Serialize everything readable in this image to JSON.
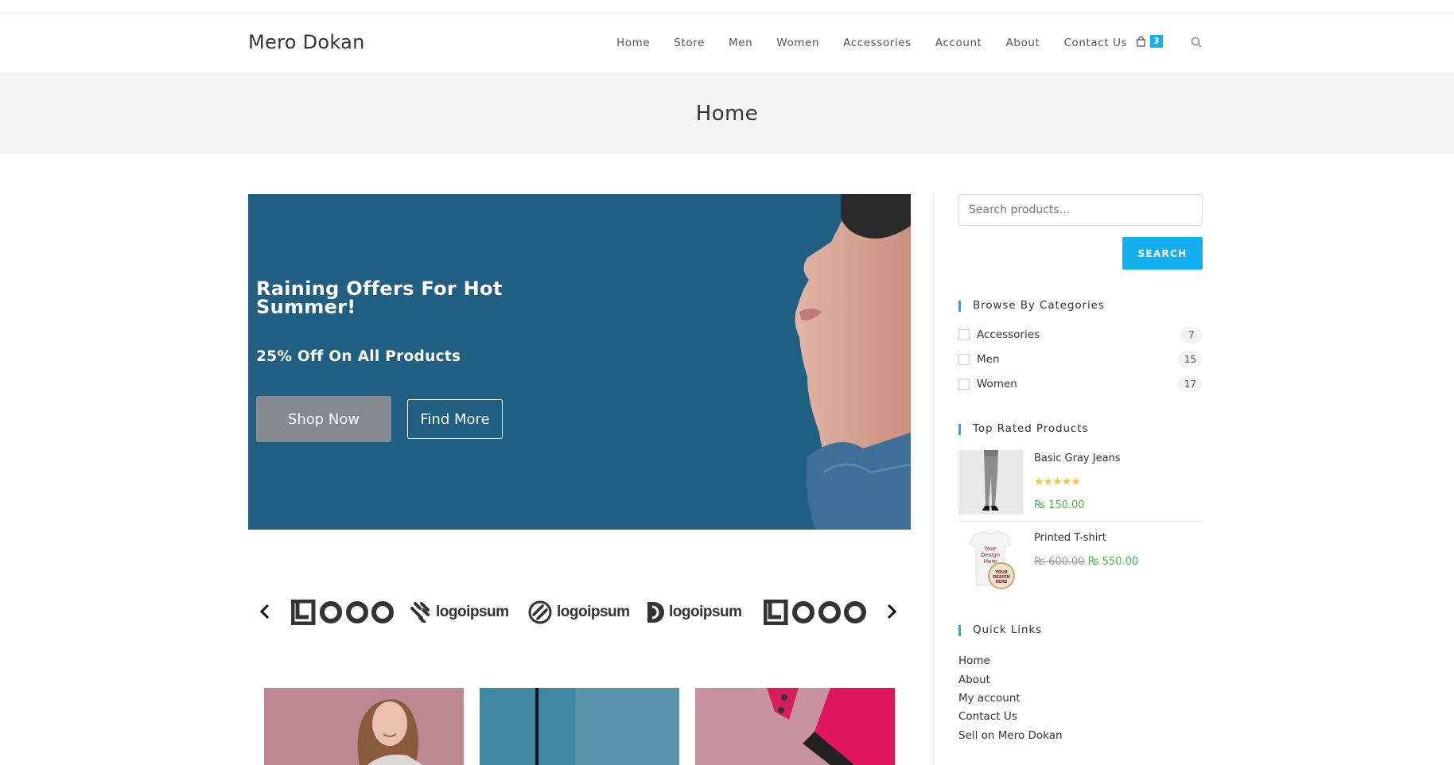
{
  "site": {
    "title": "Mero Dokan"
  },
  "nav": {
    "items": [
      "Home",
      "Store",
      "Men",
      "Women",
      "Accessories",
      "Account",
      "About",
      "Contact Us"
    ],
    "cart_count": "3",
    "icons": {
      "cart": "shopping-bag-icon",
      "search": "search-icon"
    }
  },
  "page_header": {
    "title": "Home"
  },
  "hero": {
    "title": "Raining Offers For Hot Summer!",
    "subtitle": "25% Off On All Products",
    "primary_button": "Shop Now",
    "secondary_button": "Find More",
    "background_color": "#215f82"
  },
  "logos": {
    "items": [
      "LOGO",
      "logoipsum",
      "logoipsum",
      "logoipsum",
      "LOGO"
    ]
  },
  "sidebar": {
    "search": {
      "placeholder": "Search products...",
      "button": "SEARCH"
    },
    "categories": {
      "title": "Browse By Categories",
      "items": [
        {
          "name": "Accessories",
          "count": "7"
        },
        {
          "name": "Men",
          "count": "15"
        },
        {
          "name": "Women",
          "count": "17"
        }
      ]
    },
    "top_rated": {
      "title": "Top Rated Products",
      "items": [
        {
          "name": "Basic Gray Jeans",
          "rating": 5,
          "price": "₨ 150.00",
          "old_price": ""
        },
        {
          "name": "Printed T-shirt",
          "rating": 0,
          "price": "₨ 550.00",
          "old_price": "₨ 600.00"
        }
      ],
      "tshirt_print": "Your Design Here"
    },
    "quick_links": {
      "title": "Quick Links",
      "items": [
        "Home",
        "About",
        "My account",
        "Contact Us",
        "Sell on Mero Dokan"
      ]
    }
  },
  "colors": {
    "accent": "#13aff0",
    "price": "#4caf50",
    "star": "#f4c54a"
  }
}
